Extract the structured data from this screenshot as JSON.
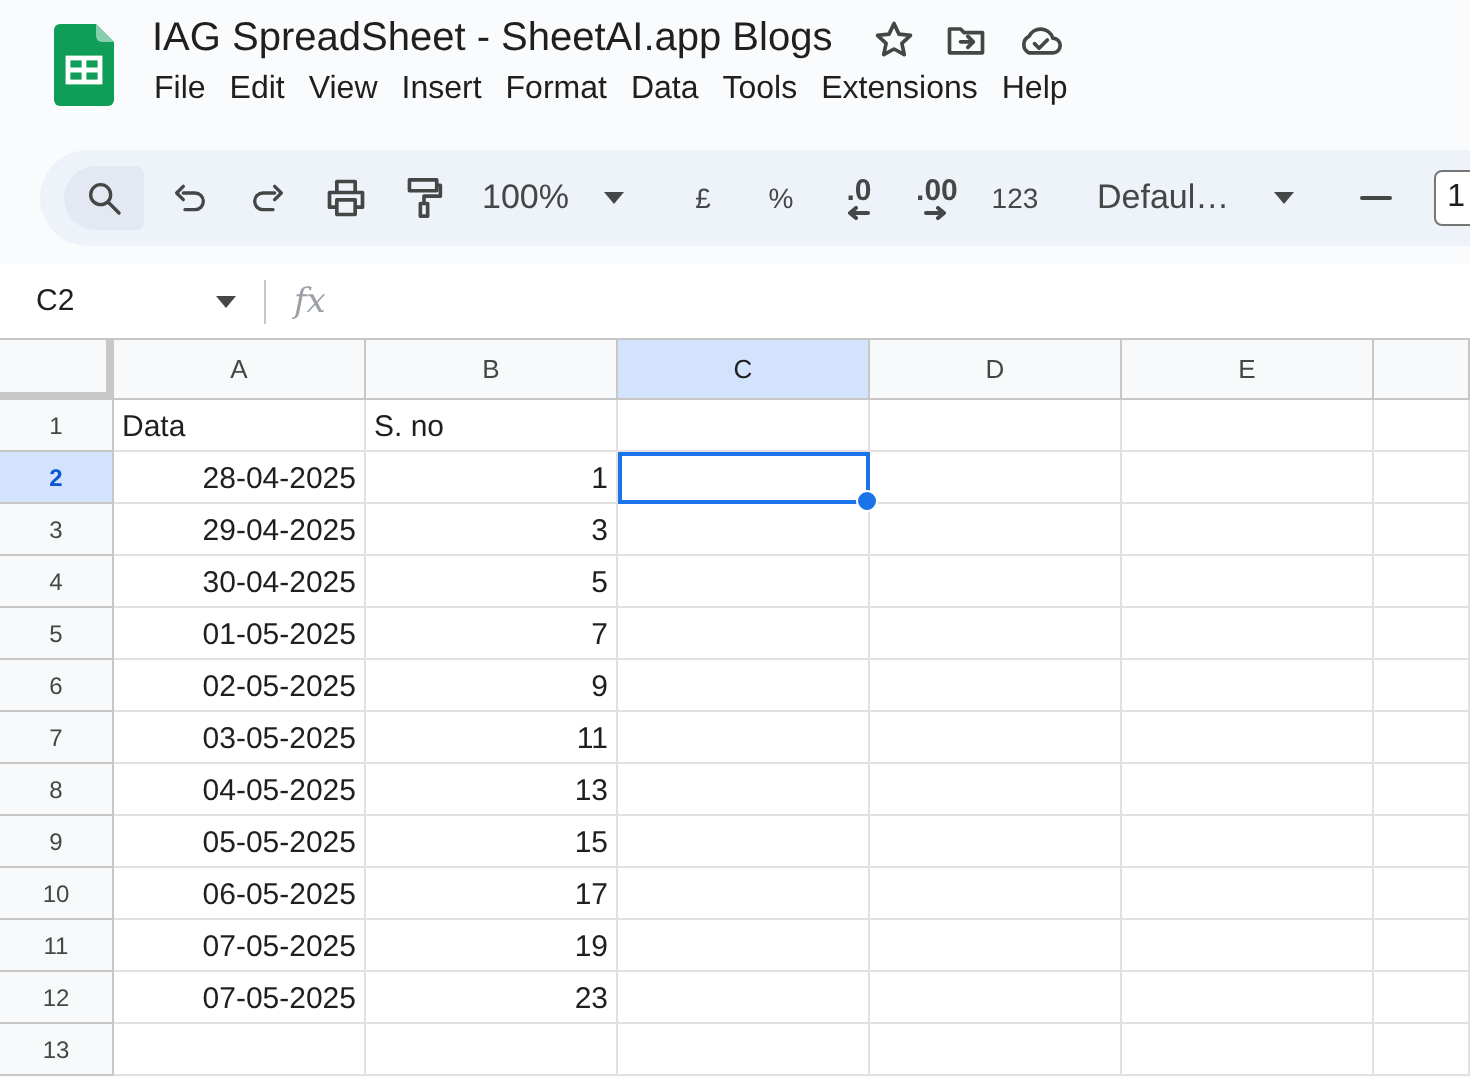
{
  "document": {
    "title": "IAG SpreadSheet - SheetAI.app Blogs"
  },
  "menu": [
    {
      "label": "File"
    },
    {
      "label": "Edit"
    },
    {
      "label": "View"
    },
    {
      "label": "Insert"
    },
    {
      "label": "Format"
    },
    {
      "label": "Data"
    },
    {
      "label": "Tools"
    },
    {
      "label": "Extensions"
    },
    {
      "label": "Help"
    }
  ],
  "toolbar": {
    "zoom": "100%",
    "currency": "£",
    "percent": "%",
    "decrease_decimals": ".0",
    "increase_decimals": ".00",
    "number_format": "123",
    "font": "Defaul…",
    "font_size": "1"
  },
  "formula_bar": {
    "name_box": "C2",
    "formula_label": "fx"
  },
  "columns": [
    {
      "label": "A",
      "selected": false
    },
    {
      "label": "B",
      "selected": false
    },
    {
      "label": "C",
      "selected": true
    },
    {
      "label": "D",
      "selected": false
    },
    {
      "label": "E",
      "selected": false
    }
  ],
  "rows": [
    {
      "number": "1",
      "selected": false,
      "kind": "header",
      "date": "Data",
      "s_no": "S. no"
    },
    {
      "number": "2",
      "selected": true,
      "kind": "data",
      "date": "28-04-2025",
      "s_no": "1"
    },
    {
      "number": "3",
      "selected": false,
      "kind": "data",
      "date": "29-04-2025",
      "s_no": "3"
    },
    {
      "number": "4",
      "selected": false,
      "kind": "data",
      "date": "30-04-2025",
      "s_no": "5"
    },
    {
      "number": "5",
      "selected": false,
      "kind": "data",
      "date": "01-05-2025",
      "s_no": "7"
    },
    {
      "number": "6",
      "selected": false,
      "kind": "data",
      "date": "02-05-2025",
      "s_no": "9"
    },
    {
      "number": "7",
      "selected": false,
      "kind": "data",
      "date": "03-05-2025",
      "s_no": "11"
    },
    {
      "number": "8",
      "selected": false,
      "kind": "data",
      "date": "04-05-2025",
      "s_no": "13"
    },
    {
      "number": "9",
      "selected": false,
      "kind": "data",
      "date": "05-05-2025",
      "s_no": "15"
    },
    {
      "number": "10",
      "selected": false,
      "kind": "data",
      "date": "06-05-2025",
      "s_no": "17"
    },
    {
      "number": "11",
      "selected": false,
      "kind": "data",
      "date": "07-05-2025",
      "s_no": "19"
    },
    {
      "number": "12",
      "selected": false,
      "kind": "data",
      "date": "07-05-2025",
      "s_no": "23"
    },
    {
      "number": "13",
      "selected": false,
      "kind": "empty"
    }
  ]
}
